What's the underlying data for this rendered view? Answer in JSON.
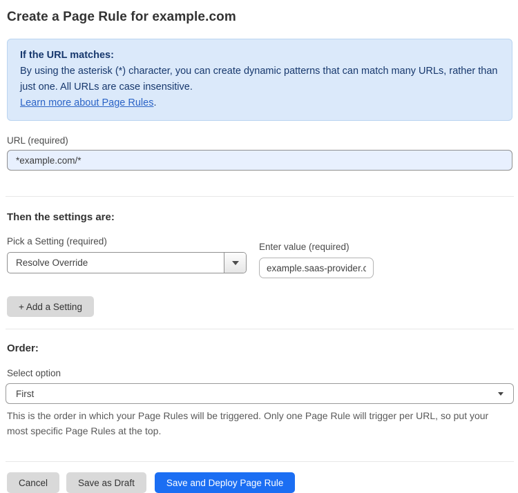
{
  "page": {
    "title": "Create a Page Rule for example.com"
  },
  "info_box": {
    "heading": "If the URL matches:",
    "body": "By using the asterisk (*) character, you can create dynamic patterns that can match many URLs, rather than just one. All URLs are case insensitive.",
    "link_label": "Learn more about Page Rules",
    "link_suffix": "."
  },
  "url_field": {
    "label": "URL (required)",
    "value": "*example.com/*"
  },
  "settings_section": {
    "heading": "Then the settings are:",
    "setting_label": "Pick a Setting (required)",
    "setting_selected": "Resolve Override",
    "value_label": "Enter value (required)",
    "value_text": "example.saas-provider.c",
    "add_setting_label": "+ Add a Setting"
  },
  "order_section": {
    "heading": "Order:",
    "select_label": "Select option",
    "select_selected": "First",
    "help_text": "This is the order in which your Page Rules will be triggered. Only one Page Rule will trigger per URL, so put your most specific Page Rules at the top."
  },
  "footer": {
    "cancel_label": "Cancel",
    "save_draft_label": "Save as Draft",
    "save_deploy_label": "Save and Deploy Page Rule"
  },
  "colors": {
    "info_box_bg": "#dbe9fa",
    "info_box_border": "#bad4f0",
    "info_box_text": "#17386d",
    "link_blue": "#2a63c6",
    "autofill_input_bg": "#e8f0fe",
    "primary_button_bg": "#1b6ef3",
    "gray_button_bg": "#d9d9d9"
  }
}
